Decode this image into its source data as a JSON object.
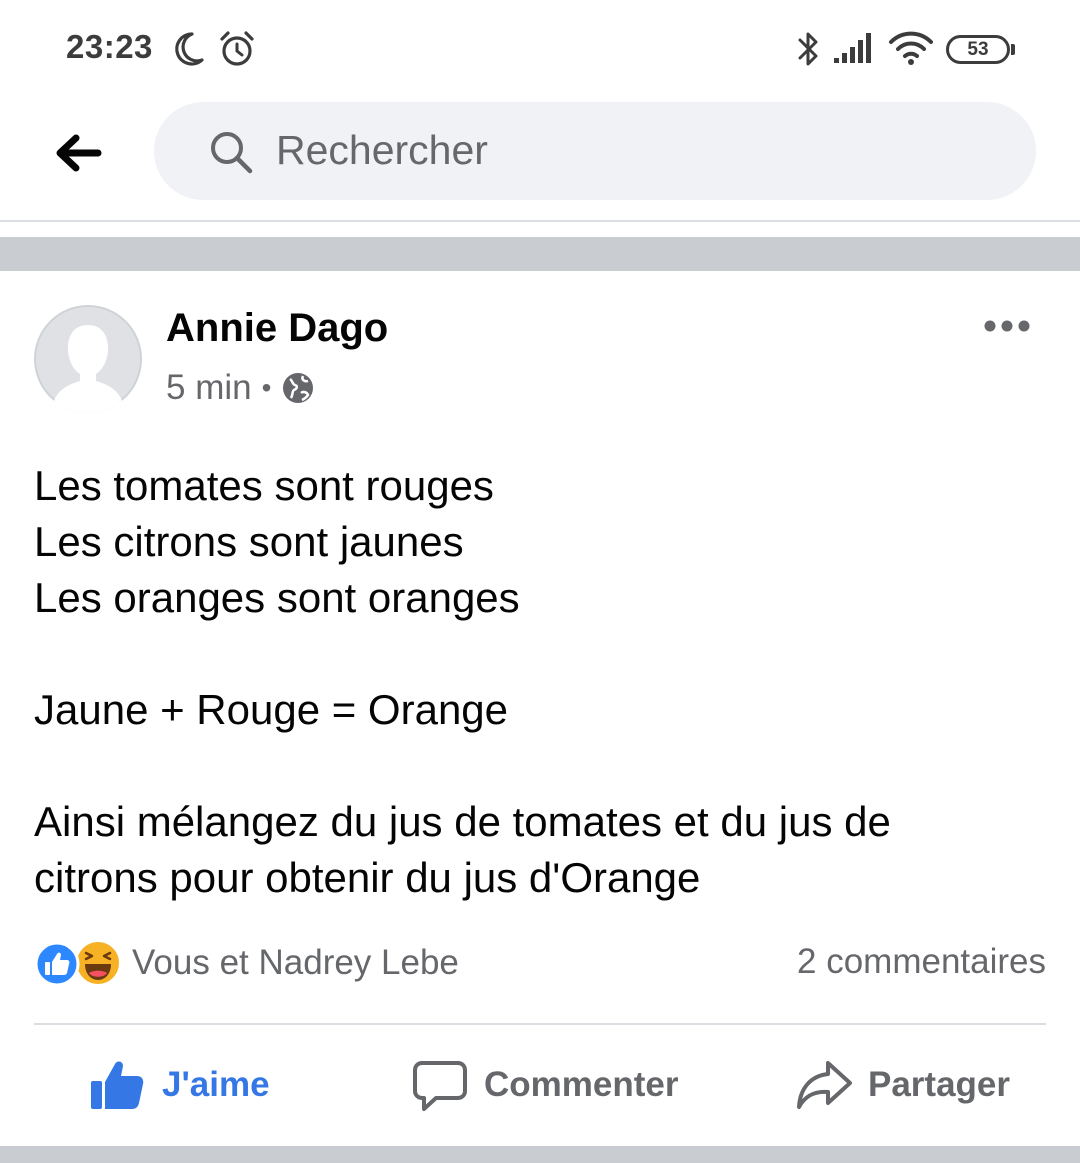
{
  "status_bar": {
    "time": "23:23",
    "battery": "53",
    "icons": [
      "moon-icon",
      "alarm-icon",
      "bluetooth-icon",
      "signal-icon",
      "wifi-icon",
      "battery-icon"
    ]
  },
  "header": {
    "back_icon": "arrow-left-icon",
    "search_placeholder": "Rechercher",
    "search_icon": "search-icon"
  },
  "post": {
    "author": "Annie Dago",
    "time": "5 min",
    "separator": "•",
    "privacy_icon": "globe-icon",
    "more_icon": "more-options-icon",
    "lines": [
      "Les tomates sont rouges",
      "Les citrons sont jaunes",
      "Les oranges sont oranges",
      "",
      "Jaune + Rouge = Orange",
      "",
      "Ainsi mélangez du jus de tomates et du jus de",
      "citrons pour obtenir du jus d'Orange"
    ],
    "reactions": {
      "icons": [
        "like-reaction-icon",
        "haha-reaction-icon"
      ],
      "names": "Vous et Nadrey Lebe"
    },
    "comments": "2 commentaires"
  },
  "actions": {
    "like": "J'aime",
    "comment": "Commenter",
    "share": "Partager"
  },
  "colors": {
    "like_active": "#3578e5",
    "secondary_text": "#65676b",
    "separator": "#c9ccd1",
    "search_bg": "#f0f2f5"
  }
}
